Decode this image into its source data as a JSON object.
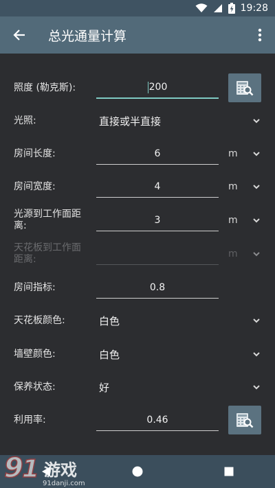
{
  "status": {
    "time": "19:28"
  },
  "app_bar": {
    "title": "总光通量计算"
  },
  "rows": [
    {
      "id": "illuminance",
      "label": "照度 (勒克斯):",
      "value": "200"
    },
    {
      "id": "lighting",
      "label": "光照:",
      "value": "直接或半直接"
    },
    {
      "id": "room-length",
      "label": "房间长度:",
      "value": "6",
      "unit": "m"
    },
    {
      "id": "room-width",
      "label": "房间宽度:",
      "value": "4",
      "unit": "m"
    },
    {
      "id": "light-to-work",
      "label": "光源到工作面距离:",
      "value": "3",
      "unit": "m"
    },
    {
      "id": "ceiling-to-work",
      "label": "天花板到工作面距离:",
      "value": "",
      "unit": "m"
    },
    {
      "id": "room-index",
      "label": "房间指标:",
      "value": "0.8"
    },
    {
      "id": "ceiling-color",
      "label": "天花板颜色:",
      "value": "白色"
    },
    {
      "id": "wall-color",
      "label": "墙壁颜色:",
      "value": "白色"
    },
    {
      "id": "maintenance",
      "label": "保养状态:",
      "value": "好"
    },
    {
      "id": "utilization",
      "label": "利用率:",
      "value": "0.46"
    }
  ],
  "watermark": {
    "logo": "91游戏",
    "url": "91danji.com"
  },
  "colors": {
    "status_bar": "#3f5362",
    "app_bar": "#526a79",
    "background": "#2c2d30",
    "accent": "#80cbc4",
    "calc_button": "#5b7280",
    "nav_bar": "#3b4e5c"
  },
  "icons": {
    "back": "arrow-left-icon",
    "menu": "more-vert-icon",
    "dropdown": "chevron-down-icon",
    "calculator": "calculator-search-icon",
    "nav_back": "triangle-back-icon",
    "nav_home": "circle-home-icon",
    "nav_recents": "square-recents-icon"
  }
}
